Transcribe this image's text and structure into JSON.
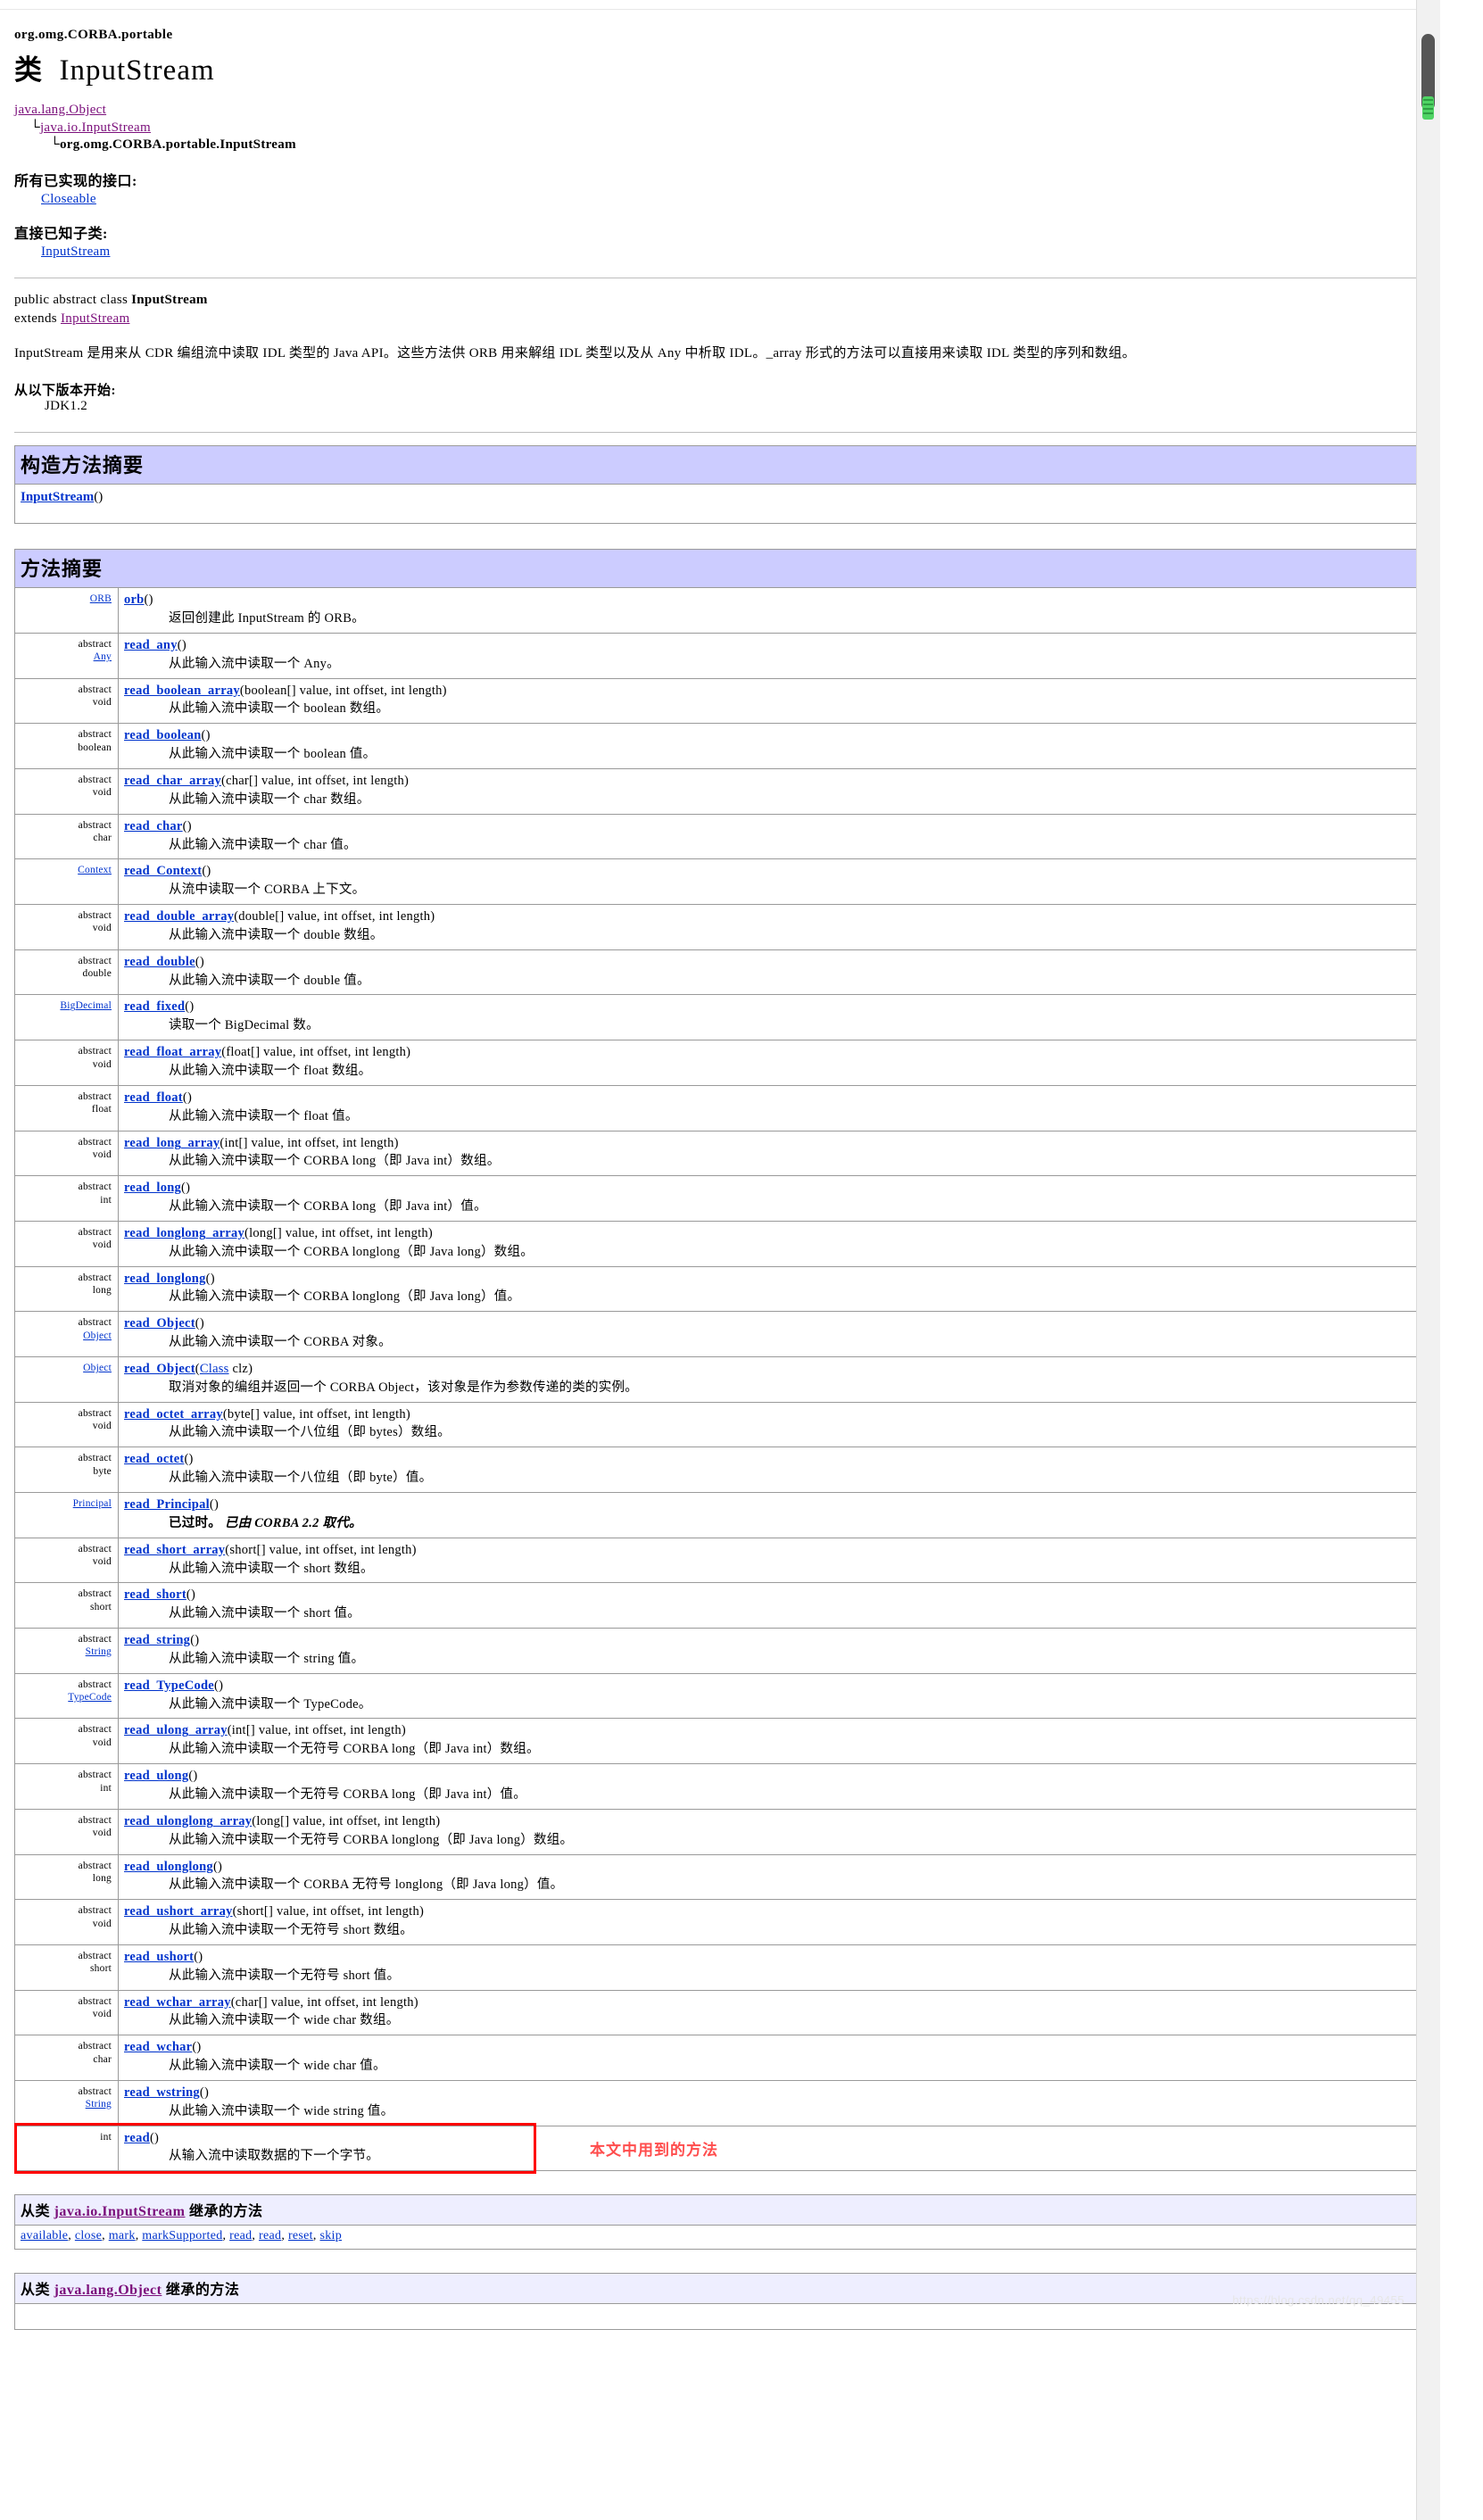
{
  "header": {
    "package": "org.omg.CORBA.portable",
    "class_label": "类",
    "class_name": "InputStream"
  },
  "hierarchy": [
    {
      "indent": 0,
      "prefix": "",
      "text": "java.lang.Object",
      "link": true
    },
    {
      "indent": 1,
      "prefix": "└",
      "text": "java.io.InputStream",
      "link": true
    },
    {
      "indent": 2,
      "prefix": "└",
      "text": "org.omg.CORBA.portable.InputStream",
      "link": false
    }
  ],
  "implemented": {
    "label": "所有已实现的接口:",
    "items": [
      "Closeable"
    ]
  },
  "subclasses": {
    "label": "直接已知子类:",
    "items": [
      "InputStream"
    ]
  },
  "declaration": {
    "line1_pre": "public abstract class ",
    "line1_name": "InputStream",
    "line2_pre": "extends ",
    "line2_link": "InputStream"
  },
  "description": "InputStream 是用来从 CDR 编组流中读取 IDL 类型的 Java API。这些方法供 ORB 用来解组 IDL 类型以及从 Any 中析取 IDL。_array 形式的方法可以直接用来读取 IDL 类型的序列和数组。",
  "since": {
    "label": "从以下版本开始:",
    "value": "JDK1.2"
  },
  "constructor_summary": {
    "title": "构造方法摘要",
    "entries": [
      {
        "name": "InputStream",
        "params": "()"
      }
    ]
  },
  "method_summary": {
    "title": "方法摘要",
    "methods": [
      {
        "modifier": "",
        "type": "ORB",
        "type_link": true,
        "name": "orb",
        "params": "()",
        "desc": "返回创建此 InputStream 的 ORB。",
        "deprecated": false,
        "highlight": false
      },
      {
        "modifier": "abstract",
        "type": "Any",
        "type_link": true,
        "name": "read_any",
        "params": "()",
        "desc": "从此输入流中读取一个 Any。",
        "deprecated": false,
        "highlight": false
      },
      {
        "modifier": "abstract",
        "type": "void",
        "type_link": false,
        "name": "read_boolean_array",
        "params": "(boolean[] value, int offset, int length)",
        "desc": "从此输入流中读取一个 boolean 数组。",
        "deprecated": false,
        "highlight": false
      },
      {
        "modifier": "abstract",
        "type": "boolean",
        "type_link": false,
        "name": "read_boolean",
        "params": "()",
        "desc": "从此输入流中读取一个 boolean 值。",
        "deprecated": false,
        "highlight": false
      },
      {
        "modifier": "abstract",
        "type": "void",
        "type_link": false,
        "name": "read_char_array",
        "params": "(char[] value, int offset, int length)",
        "desc": "从此输入流中读取一个 char 数组。",
        "deprecated": false,
        "highlight": false
      },
      {
        "modifier": "abstract",
        "type": "char",
        "type_link": false,
        "name": "read_char",
        "params": "()",
        "desc": "从此输入流中读取一个 char 值。",
        "deprecated": false,
        "highlight": false
      },
      {
        "modifier": "",
        "type": "Context",
        "type_link": true,
        "name": "read_Context",
        "params": "()",
        "desc": "从流中读取一个 CORBA 上下文。",
        "deprecated": false,
        "highlight": false
      },
      {
        "modifier": "abstract",
        "type": "void",
        "type_link": false,
        "name": "read_double_array",
        "params": "(double[] value, int offset, int length)",
        "desc": "从此输入流中读取一个 double 数组。",
        "deprecated": false,
        "highlight": false
      },
      {
        "modifier": "abstract",
        "type": "double",
        "type_link": false,
        "name": "read_double",
        "params": "()",
        "desc": "从此输入流中读取一个 double 值。",
        "deprecated": false,
        "highlight": false
      },
      {
        "modifier": "",
        "type": "BigDecimal",
        "type_link": true,
        "name": "read_fixed",
        "params": "()",
        "desc": "读取一个 BigDecimal 数。",
        "deprecated": false,
        "highlight": false
      },
      {
        "modifier": "abstract",
        "type": "void",
        "type_link": false,
        "name": "read_float_array",
        "params": "(float[] value, int offset, int length)",
        "desc": "从此输入流中读取一个 float 数组。",
        "deprecated": false,
        "highlight": false
      },
      {
        "modifier": "abstract",
        "type": "float",
        "type_link": false,
        "name": "read_float",
        "params": "()",
        "desc": "从此输入流中读取一个 float 值。",
        "deprecated": false,
        "highlight": false
      },
      {
        "modifier": "abstract",
        "type": "void",
        "type_link": false,
        "name": "read_long_array",
        "params": "(int[] value, int offset, int length)",
        "desc": "从此输入流中读取一个 CORBA long（即 Java int）数组。",
        "deprecated": false,
        "highlight": false
      },
      {
        "modifier": "abstract",
        "type": "int",
        "type_link": false,
        "name": "read_long",
        "params": "()",
        "desc": "从此输入流中读取一个 CORBA long（即 Java int）值。",
        "deprecated": false,
        "highlight": false
      },
      {
        "modifier": "abstract",
        "type": "void",
        "type_link": false,
        "name": "read_longlong_array",
        "params": "(long[] value, int offset, int length)",
        "desc": "从此输入流中读取一个 CORBA longlong（即 Java long）数组。",
        "deprecated": false,
        "highlight": false
      },
      {
        "modifier": "abstract",
        "type": "long",
        "type_link": false,
        "name": "read_longlong",
        "params": "()",
        "desc": "从此输入流中读取一个 CORBA longlong（即 Java long）值。",
        "deprecated": false,
        "highlight": false
      },
      {
        "modifier": "abstract",
        "type": "Object",
        "type_link": true,
        "name": "read_Object",
        "params": "()",
        "desc": "从此输入流中读取一个 CORBA 对象。",
        "deprecated": false,
        "highlight": false
      },
      {
        "modifier": "",
        "type": "Object",
        "type_link": true,
        "name": "read_Object",
        "params": "(Class clz)",
        "params_link": "Class",
        "desc": "取消对象的编组并返回一个 CORBA Object，该对象是作为参数传递的类的实例。",
        "deprecated": false,
        "highlight": false
      },
      {
        "modifier": "abstract",
        "type": "void",
        "type_link": false,
        "name": "read_octet_array",
        "params": "(byte[] value, int offset, int length)",
        "desc": "从此输入流中读取一个八位组（即 bytes）数组。",
        "deprecated": false,
        "highlight": false
      },
      {
        "modifier": "abstract",
        "type": "byte",
        "type_link": false,
        "name": "read_octet",
        "params": "()",
        "desc": "从此输入流中读取一个八位组（即 byte）值。",
        "deprecated": false,
        "highlight": false
      },
      {
        "modifier": "",
        "type": "Principal",
        "type_link": true,
        "name": "read_Principal",
        "params": "()",
        "desc": "已过时。",
        "desc_italic": "已由 CORBA 2.2 取代。",
        "deprecated": true,
        "highlight": false
      },
      {
        "modifier": "abstract",
        "type": "void",
        "type_link": false,
        "name": "read_short_array",
        "params": "(short[] value, int offset, int length)",
        "desc": "从此输入流中读取一个 short 数组。",
        "deprecated": false,
        "highlight": false
      },
      {
        "modifier": "abstract",
        "type": "short",
        "type_link": false,
        "name": "read_short",
        "params": "()",
        "desc": "从此输入流中读取一个 short 值。",
        "deprecated": false,
        "highlight": false
      },
      {
        "modifier": "abstract",
        "type": "String",
        "type_link": true,
        "name": "read_string",
        "params": "()",
        "desc": "从此输入流中读取一个 string 值。",
        "deprecated": false,
        "highlight": false
      },
      {
        "modifier": "abstract",
        "type": "TypeCode",
        "type_link": true,
        "name": "read_TypeCode",
        "params": "()",
        "desc": "从此输入流中读取一个 TypeCode。",
        "deprecated": false,
        "highlight": false
      },
      {
        "modifier": "abstract",
        "type": "void",
        "type_link": false,
        "name": "read_ulong_array",
        "params": "(int[] value, int offset, int length)",
        "desc": "从此输入流中读取一个无符号 CORBA long（即 Java int）数组。",
        "deprecated": false,
        "highlight": false
      },
      {
        "modifier": "abstract",
        "type": "int",
        "type_link": false,
        "name": "read_ulong",
        "params": "()",
        "desc": "从此输入流中读取一个无符号 CORBA long（即 Java int）值。",
        "deprecated": false,
        "highlight": false
      },
      {
        "modifier": "abstract",
        "type": "void",
        "type_link": false,
        "name": "read_ulonglong_array",
        "params": "(long[] value, int offset, int length)",
        "desc": "从此输入流中读取一个无符号 CORBA longlong（即 Java long）数组。",
        "deprecated": false,
        "highlight": false
      },
      {
        "modifier": "abstract",
        "type": "long",
        "type_link": false,
        "name": "read_ulonglong",
        "params": "()",
        "desc": "从此输入流中读取一个 CORBA 无符号 longlong（即 Java long）值。",
        "deprecated": false,
        "highlight": false
      },
      {
        "modifier": "abstract",
        "type": "void",
        "type_link": false,
        "name": "read_ushort_array",
        "params": "(short[] value, int offset, int length)",
        "desc": "从此输入流中读取一个无符号 short 数组。",
        "deprecated": false,
        "highlight": false
      },
      {
        "modifier": "abstract",
        "type": "short",
        "type_link": false,
        "name": "read_ushort",
        "params": "()",
        "desc": "从此输入流中读取一个无符号 short 值。",
        "deprecated": false,
        "highlight": false
      },
      {
        "modifier": "abstract",
        "type": "void",
        "type_link": false,
        "name": "read_wchar_array",
        "params": "(char[] value, int offset, int length)",
        "desc": "从此输入流中读取一个 wide char 数组。",
        "deprecated": false,
        "highlight": false
      },
      {
        "modifier": "abstract",
        "type": "char",
        "type_link": false,
        "name": "read_wchar",
        "params": "()",
        "desc": "从此输入流中读取一个 wide char 值。",
        "deprecated": false,
        "highlight": false
      },
      {
        "modifier": "abstract",
        "type": "String",
        "type_link": true,
        "name": "read_wstring",
        "params": "()",
        "desc": "从此输入流中读取一个 wide string 值。",
        "deprecated": false,
        "highlight": false
      },
      {
        "modifier": "",
        "type": "int",
        "type_link": false,
        "name": "read",
        "params": "()",
        "desc": "从输入流中读取数据的下一个字节。",
        "deprecated": false,
        "highlight": true
      }
    ]
  },
  "annotation": {
    "text": "本文中用到的方法",
    "color": "#ff4d4d",
    "box_color": "#ff0000"
  },
  "inherited_sections": [
    {
      "title_pre": "从类 ",
      "title_link": "java.io.InputStream",
      "title_post": " 继承的方法",
      "members": [
        "available",
        "close",
        "mark",
        "markSupported",
        "read",
        "read",
        "reset",
        "skip"
      ]
    },
    {
      "title_pre": "从类 ",
      "title_link": "java.lang.Object",
      "title_post": " 继承的方法",
      "members": []
    }
  ],
  "watermark": "https://blog.csdn.net/qq_49455",
  "colors": {
    "section_header_bg": "#ccccff",
    "inherited_header_bg": "#eeeeff",
    "link_blue": "#0033cc",
    "link_purple": "#7b0f7b",
    "border": "#9a9a9a"
  }
}
